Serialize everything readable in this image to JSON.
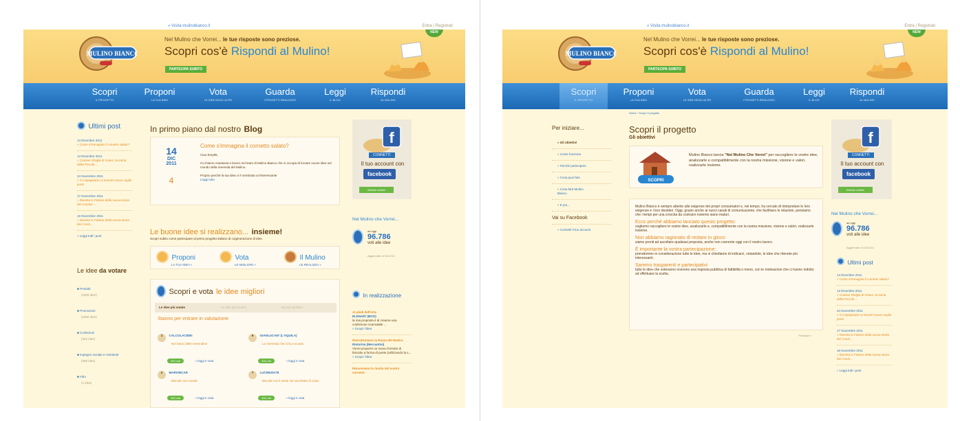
{
  "colors": {
    "accent": "#2a86d1",
    "nav": "#1c68b5",
    "orange": "#e08a1e",
    "green": "#6bb843",
    "facebook": "#2f5fa8"
  },
  "header": {
    "visit": "» Visita mulinobianco.it",
    "login": "Entra | Registrati",
    "tagline_pre": "Nel Mulino che Vorrei...",
    "tagline_bold": "le tue risposte sono preziose.",
    "scopri_pre": "Scopri cos'è",
    "scopri_accent": "Rispondi al Mulino!",
    "cta": "PARTECIPA SUBITO",
    "new_badge": "NEW",
    "logo": "MULINO BIANCO"
  },
  "nav": [
    {
      "label": "Scopri",
      "sub": "IL PROGETTO"
    },
    {
      "label": "Proponi",
      "sub": "LA TUA IDEA"
    },
    {
      "label": "Vota",
      "sub": "LE IDEE DEGLI ALTRI"
    },
    {
      "label": "Guarda",
      "sub": "I PROGETTI REALIZZATI"
    },
    {
      "label": "Leggi",
      "sub": "IL BLOG"
    },
    {
      "label": "Rispondi",
      "sub": "AL MULINO"
    }
  ],
  "left_page": {
    "ultimi_post_title": "Ultimi post",
    "posts": [
      {
        "date": "14 Dicembre 2011",
        "text": "» Come s'immagina il cornetto salato?"
      },
      {
        "date": "13 Dicembre 2011",
        "text": "» Cracker Sfoglia di Grano: la storia della Piccola ..."
      },
      {
        "date": "24 Novembre 2011",
        "text": "» Ci impegniamo a trovare nuove soglie punti"
      },
      {
        "date": "17 Novembre 2011",
        "text": "» Diventa IL Fattore della nuova storia dei Cracker ..."
      },
      {
        "date": "16 Novembre 2011",
        "text": "» Diventa IL Fattore della nuova storia dei Crack..."
      }
    ],
    "all_posts": "» Leggi tutti i post",
    "blog_title_pre": "In primo piano dal nostro",
    "blog_title_bold": "Blog",
    "blog_post": {
      "day": "14",
      "month": "DIC",
      "year": "2011",
      "title": "Come s'immagina il cornetto salato?",
      "greeting": "Ciao Emy85,",
      "body": "mi chiamo Anastasia e lavoro nel team di Mulino Bianco che si occupa di trovare nuove idee nel mondo della merenda del Mulino.",
      "body2": "Proprio perché la tua idea ci è sembrata un'interessante",
      "more": "Leggi tutto",
      "comments": "4"
    },
    "buone_idee_pre": "Le buone idee si realizzano...",
    "buone_idee_bold": "insieme!",
    "buone_sub": "Scopri subito come partecipare al primo progetto italiano di cogenerazione di idee.",
    "steps": [
      {
        "label": "Proponi",
        "sub": "LA TUA IDEA »"
      },
      {
        "label": "Vota",
        "sub": "LE MIGLIORI »"
      },
      {
        "label": "Il Mulino",
        "sub": "LE REALIZZA »"
      }
    ],
    "vota_title_pre": "Scopri e vota",
    "vota_title_post": "le idee migliori",
    "tabs": [
      "Le idee più votate",
      "Le idee più recenti",
      "Da non perdere"
    ],
    "rank_title": "Stanno per entrare in valutazione",
    "ideas": [
      {
        "rank": "1",
        "user": "CALCOLACIDEI",
        "desc": "Nei tranci delle merendine",
        "votes": "300 voti"
      },
      {
        "rank": "6",
        "user": "GIANLUCA87 (L'AQUILA)",
        "desc": "La merenda che si fa a scuola",
        "votes": "300 voti"
      },
      {
        "rank": "2",
        "user": "MARVINCAR",
        "desc": "Biscotti con cereali",
        "votes": "300 voti"
      },
      {
        "rank": "7",
        "user": "LUCREZIA78",
        "desc": "Biscotti con il miele nel sacchetto di carta",
        "votes": "300 voti"
      }
    ],
    "read_vote": "» leggi e vota",
    "idee_votare_pre": "Le idee",
    "idee_votare_bold": "da votare",
    "categories": [
      {
        "name": "Prodotti",
        "count": "(1509 idee)"
      },
      {
        "name": "Promozioni",
        "count": "(1850 idee)"
      },
      {
        "name": "Confezioni",
        "count": "(322 idee)"
      },
      {
        "name": "Impegno sociale e Ambiente",
        "count": "(285 idee)"
      },
      {
        "name": "Altro",
        "count": "(1 idea)"
      }
    ],
    "fb_connect": "CONNETTI",
    "fb_account": "Il tuo account con",
    "fb_brand": "facebook",
    "fb_activate": "Attivalo subito!",
    "nel_mulino": "Nel Mulino che Vorrei...",
    "counter_label": "ad oggi",
    "counter_value": "96.786",
    "counter_unit": "voti alle idee",
    "counter_updated": "Aggiornato al 16/12/11",
    "in_realizzazione": "In realizzazione",
    "realiz_1_title": "Ai piedi dell'erta",
    "realiz_1_user": "ELENA87 (BOO)",
    "realiz_1_text": "la mia proposta è di crearne una confezione ricaricabile ...",
    "realiz_1_more": "» Scopri l'idea",
    "realiz_2_title": "Ristrutturiamo la Ruota del Mulino",
    "realiz_2_user": "Ristorina (Mercantini)",
    "realiz_2_text": "Vorrei proporre un nuovo formato di biscotto a forma di ponte (utilizzando la s...",
    "realiz_2_more": "» Scopri l'idea",
    "realiz_3_title": "Rinnoviamo la ricetta del nostro cornetto"
  },
  "right_page": {
    "breadcrumb": "Home › Scopri il progetto",
    "sidebar_title": "Per iniziare...",
    "sidebar_items": [
      "Gli obiettivi",
      "Come funziona",
      "Perché partecipare",
      "Cosa puoi fare",
      "Cosa farà Mulino Bianco",
      "E poi..."
    ],
    "facebook_title": "Vai su Facebook",
    "facebook_link": "Connetti il tuo account",
    "page_title": "Scopri il progetto",
    "page_sub": "Gli obiettivi",
    "intro_pre": "Mulino Bianco lancia",
    "intro_bold": "\"Nel Mulino Che Vorrei\"",
    "intro_post": "per raccogliere le vostre idee, analizzarle e compatibilmente con la nostra missione, visione e valori, realizzarle insieme.",
    "intro_badge": "SCOPRI",
    "para1": "Mulino Bianco è sempre attento alle esigenze dei propri consumatori e, nel tempo, ha cercato di interpretare le loro esigenze e i loro desideri. Oggi, grazie anche ai nuovi canali di comunicazione, che facilitano le relazioni, pensiamo che i tempi per una crescita da costruire insieme siano maturi.",
    "sections": [
      {
        "title": "Ecco perché abbiamo lanciato questo progetto:",
        "text": "vogliamo raccogliere le vostre idee, analizzarle e, compatibilmente con la nostra missione, visione e valori, realizzarle insieme."
      },
      {
        "title": "Non abbiamo ragionato di restare in gioco:",
        "text": "siamo pronti ad ascoltare qualsiasi proposta, anche non coerente oggi con il nostro lavoro."
      },
      {
        "title": "È importante la vostra partecipazione:",
        "text": "prenderemo in considerazione tutte le idee, ma vi chiediamo di indicarci, votandole, le idee che ritenete più interessanti."
      },
      {
        "title": "Saremo trasparenti e partecipativi:",
        "text": "tutte le idee che voteranno ricevono una risposta pubblica di fattibilità o meno, con le motivazioni che ci hanno indotto ad effettuare la scelta."
      }
    ],
    "next": "Prosegui »",
    "fb_connect": "CONNETTI",
    "fb_account": "Il tuo account con",
    "fb_brand": "facebook",
    "fb_activate": "Attivalo subito!",
    "nel_mulino": "Nel Mulino che Vorrei...",
    "counter_label": "ad oggi",
    "counter_value": "96.786",
    "counter_unit": "voti alle idee",
    "counter_updated": "Aggiornato al 16/12/11",
    "ultimi_post_title": "Ultimi post",
    "posts": [
      {
        "date": "14 Dicembre 2011",
        "text": "» Come s'immagina il cornetto salato?"
      },
      {
        "date": "13 Dicembre 2011",
        "text": "» Cracker Sfoglia di Grano: la storia della Piccola ..."
      },
      {
        "date": "24 Novembre 2011",
        "text": "» Ci impegniamo a trovare nuove soglie punti"
      },
      {
        "date": "17 Novembre 2011",
        "text": "» Diventa IL Fattore della nuova storia dei Crack..."
      },
      {
        "date": "16 Novembre 2011",
        "text": "» Diventa IL Fattore della nuova storia dei Crack..."
      }
    ],
    "all_posts": "» Leggi tutti i post"
  }
}
